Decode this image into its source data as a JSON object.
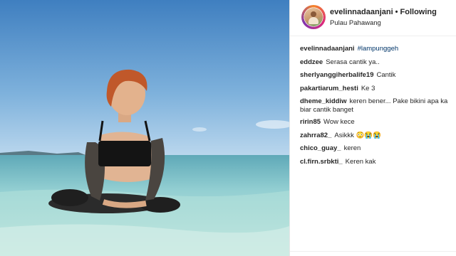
{
  "post": {
    "username": "evelinnadaanjani",
    "separator": "•",
    "follow_label": "Following",
    "location": "Pulau Pahawang"
  },
  "caption": {
    "username": "evelinnadaanjani",
    "hashtag": "#lampunggeh"
  },
  "comments": [
    {
      "user": "eddzee",
      "text": "Serasa cantik ya.."
    },
    {
      "user": "sherlyanggiherbalife19",
      "text": "Cantik"
    },
    {
      "user": "pakartiarum_hesti",
      "text": "Ke 3"
    },
    {
      "user": "dheme_kiddiw",
      "text": "keren bener... Pake bikini apa ka biar cantik banget"
    },
    {
      "user": "ririn85",
      "text": "Wow kece"
    },
    {
      "user": "zahrra82_",
      "text": "Asikkk 😳😭😭"
    },
    {
      "user": "chico_guay_",
      "text": "keren"
    },
    {
      "user": "cl.firn.srbkti_",
      "text": "Keren kak"
    }
  ]
}
